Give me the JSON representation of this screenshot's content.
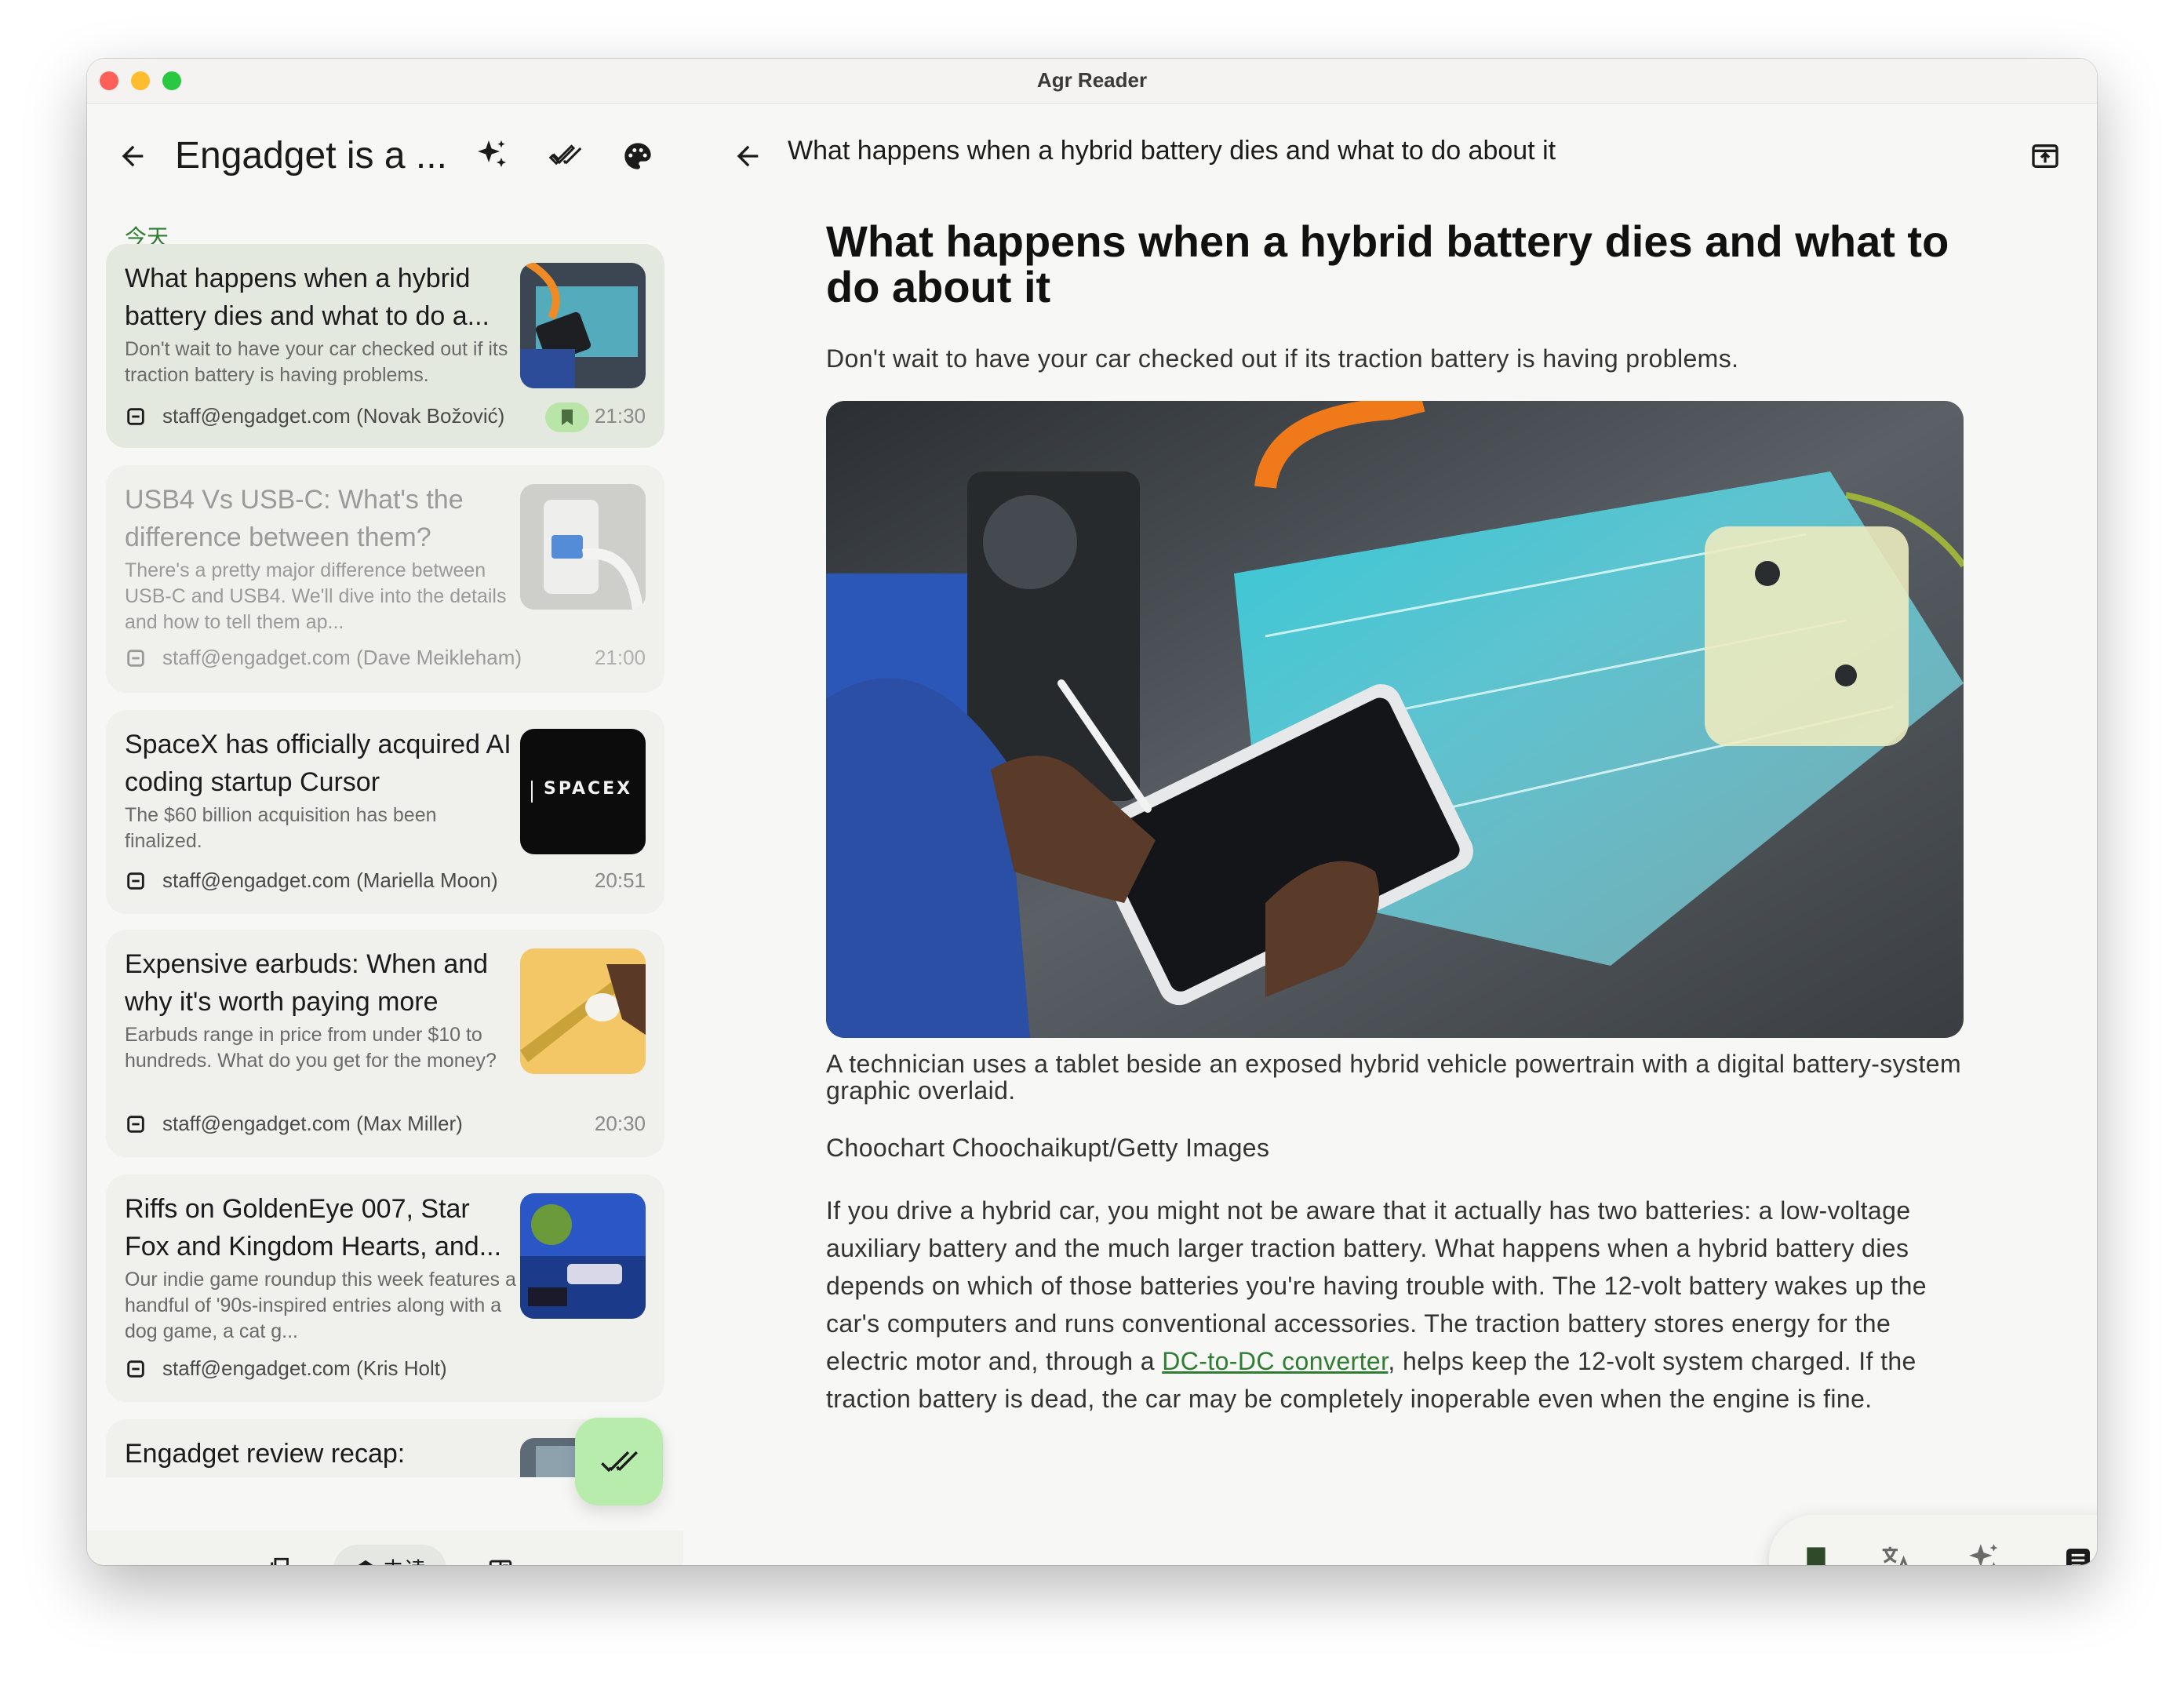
{
  "window": {
    "title": "Agr Reader"
  },
  "left": {
    "feed_title": "Engadget is a ...",
    "section_label": "今天",
    "articles": [
      {
        "title": "What happens when a hybrid battery dies and what to do a...",
        "desc": "Don't wait to have your car checked out if its traction battery is having problems.",
        "author": "staff@engadget.com (Novak Božović)",
        "time": "21:30",
        "starred": true
      },
      {
        "title": "USB4 Vs USB-C: What's the difference between them?",
        "desc": "There's a pretty major difference between USB-C and USB4. We'll dive into the details and how to tell them ap...",
        "author": "staff@engadget.com (Dave Meikleham)",
        "time": "21:00"
      },
      {
        "title": "SpaceX has officially acquired AI coding startup Cursor",
        "desc": "The $60 billion acquisition has been finalized.",
        "author": "staff@engadget.com (Mariella Moon)",
        "time": "20:51",
        "thumb_text": "SPACEX"
      },
      {
        "title": "Expensive earbuds: When and why it's worth paying more",
        "desc": "Earbuds range in price from under $10 to hundreds. What do you get for the money?",
        "author": "staff@engadget.com (Max Miller)",
        "time": "20:30"
      },
      {
        "title": "Riffs on GoldenEye 007, Star Fox and Kingdom Hearts, and...",
        "desc": "Our indie game roundup this week features a handful of '90s-inspired entries along with a dog game, a cat g...",
        "author": "staff@engadget.com (Kris Holt)"
      },
      {
        "title": "Engadget review recap:"
      }
    ],
    "bottom_nav": {
      "unread_label": "未读"
    }
  },
  "reader": {
    "bar_title": "What happens when a hybrid battery dies and what to do about it",
    "headline": "What happens when a hybrid battery dies and what to do about it",
    "subhead": "Don't wait to have your car checked out if its traction battery is having problems.",
    "caption": "A technician uses a tablet beside an exposed hybrid vehicle powertrain with a digital battery-system graphic overlaid.",
    "credit": "Choochart Choochaikupt/Getty Images",
    "body_before_link": "If you drive a hybrid car, you might not be aware that it actually has two batteries: a low-voltage auxiliary battery and the much larger traction battery. What happens when a hybrid battery dies depends on which of those batteries you're having trouble with. The 12-volt battery wakes up the car's computers and runs conventional accessories. The traction battery stores energy for the electric motor and, through a ",
    "body_link": "DC-to-DC converter",
    "body_after_link": ", helps keep the 12-volt system charged. If the traction battery is dead, the car may be completely inoperable even when the engine is fine."
  },
  "colors": {
    "accent_green": "#2e7d32",
    "fab_green": "#b8ecac",
    "selected_card": "#e4e9e0"
  },
  "icons": [
    "back-arrow-icon",
    "sparkle-icon",
    "double-check-icon",
    "palette-icon",
    "open-external-icon",
    "more-vertical-icon",
    "bookmark-icon",
    "translate-icon",
    "article-icon",
    "feed-icon",
    "unread-mail-icon",
    "split-view-icon"
  ]
}
